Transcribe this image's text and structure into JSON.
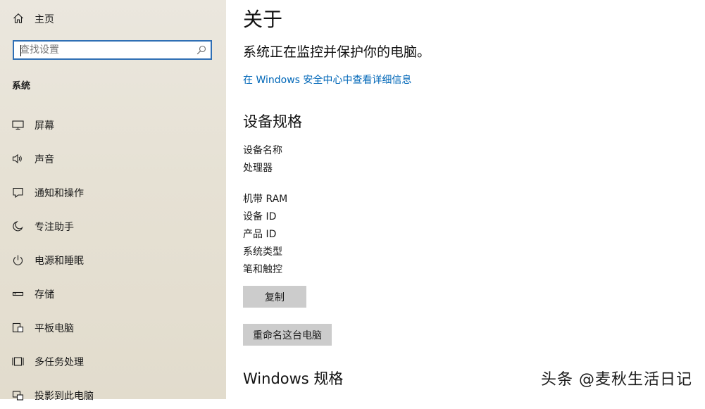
{
  "sidebar": {
    "home_label": "主页",
    "search_placeholder": "查找设置",
    "section_label": "系统",
    "items": [
      {
        "label": "屏幕",
        "icon": "monitor-icon"
      },
      {
        "label": "声音",
        "icon": "speaker-icon"
      },
      {
        "label": "通知和操作",
        "icon": "notification-icon"
      },
      {
        "label": "专注助手",
        "icon": "moon-icon"
      },
      {
        "label": "电源和睡眠",
        "icon": "power-icon"
      },
      {
        "label": "存储",
        "icon": "storage-icon"
      },
      {
        "label": "平板电脑",
        "icon": "tablet-icon"
      },
      {
        "label": "多任务处理",
        "icon": "multitask-icon"
      },
      {
        "label": "投影到此电脑",
        "icon": "project-icon"
      }
    ]
  },
  "main": {
    "title": "关于",
    "protect_message": "系统正在监控并保护你的电脑。",
    "security_link": "在 Windows 安全中心中查看详细信息",
    "device_specs": {
      "heading": "设备规格",
      "rows": [
        "设备名称",
        "处理器",
        "机带 RAM",
        "设备 ID",
        "产品 ID",
        "系统类型",
        "笔和触控"
      ]
    },
    "copy_button": "复制",
    "rename_button": "重命名这台电脑",
    "windows_specs_heading": "Windows 规格"
  },
  "watermark": "头条 @麦秋生活日记",
  "colors": {
    "accent": "#0067b8",
    "search_border": "#2f6fb5",
    "button_bg": "#cccccc",
    "sidebar_bg": "#e6e1d4"
  }
}
